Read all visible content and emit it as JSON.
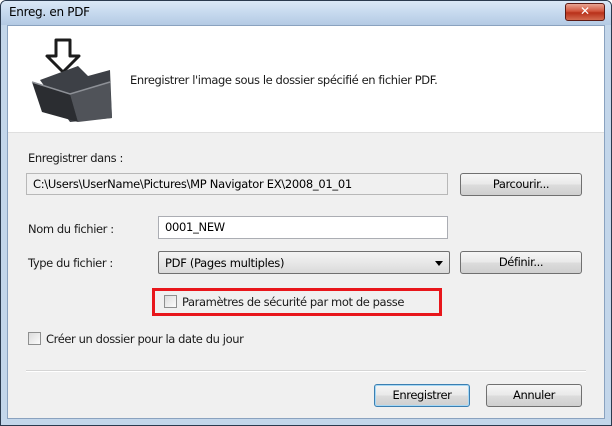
{
  "window": {
    "title": "Enreg. en PDF",
    "close_label": "✕"
  },
  "header": {
    "description": "Enregistrer l'image sous le dossier spécifié en fichier PDF.",
    "icon": "save-to-folder-icon"
  },
  "save_in": {
    "label": "Enregistrer dans :",
    "path": "C:\\Users\\UserName\\Pictures\\MP Navigator EX\\2008_01_01",
    "browse_label": "Parcourir..."
  },
  "file_name": {
    "label": "Nom du fichier :",
    "value": "0001_NEW"
  },
  "file_type": {
    "label": "Type du fichier :",
    "selected": "PDF (Pages multiples)",
    "define_label": "Définir..."
  },
  "password_security": {
    "label": "Paramètres de sécurité par mot de passe",
    "checked": false,
    "highlight_color": "#e8161b"
  },
  "create_date_folder": {
    "label": "Créer un dossier pour la date du jour",
    "checked": false
  },
  "footer": {
    "save_label": "Enregistrer",
    "cancel_label": "Annuler"
  }
}
